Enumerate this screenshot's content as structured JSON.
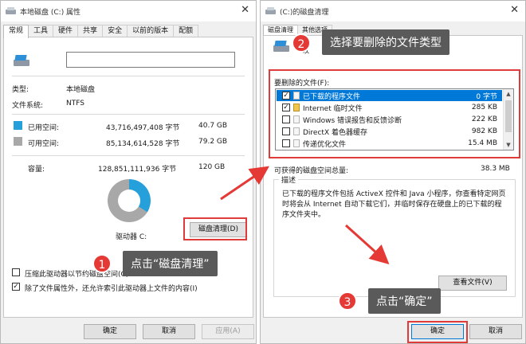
{
  "left_window": {
    "title": "本地磁盘 (C:) 属性",
    "tabs": [
      "常规",
      "工具",
      "硬件",
      "共享",
      "安全",
      "以前的版本",
      "配额"
    ],
    "type_label": "类型:",
    "type_value": "本地磁盘",
    "fs_label": "文件系统:",
    "fs_value": "NTFS",
    "used": {
      "label": "已用空间:",
      "bytes": "43,716,497,408 字节",
      "size": "40.7 GB",
      "color": "#26a0da"
    },
    "free": {
      "label": "可用空间:",
      "bytes": "85,134,614,528 字节",
      "size": "79.2 GB",
      "color": "#a8a8a8"
    },
    "capacity": {
      "label": "容量:",
      "bytes": "128,851,111,936 字节",
      "size": "120 GB"
    },
    "used_fraction": 0.339,
    "drive_label": "驱动器 C:",
    "cleanup_button": "磁盘清理(D)",
    "compress_text": "压缩此驱动器以节约磁盘空间(C)",
    "index_text": "除了文件属性外，还允许索引此驱动器上文件的内容(I)",
    "ok": "确定",
    "cancel": "取消",
    "apply": "应用(A)"
  },
  "right_window": {
    "title": "(C:)的磁盘清理",
    "tabs": [
      "磁盘清理",
      "其他选项"
    ],
    "intro_partial": "以",
    "files_label": "要删除的文件(F):",
    "files": [
      {
        "name": "已下载的程序文件",
        "size": "0 字节",
        "checked": true,
        "selected": true,
        "icon": "file-icon"
      },
      {
        "name": "Internet 临时文件",
        "size": "285 KB",
        "checked": true,
        "selected": false,
        "icon": "lock-icon"
      },
      {
        "name": "Windows 错误报告和反馈诊断",
        "size": "222 KB",
        "checked": false,
        "selected": false,
        "icon": "file-icon"
      },
      {
        "name": "DirectX 着色器缓存",
        "size": "982 KB",
        "checked": false,
        "selected": false,
        "icon": "file-icon"
      },
      {
        "name": "传递优化文件",
        "size": "15.4 MB",
        "checked": false,
        "selected": false,
        "icon": "file-icon"
      }
    ],
    "total_label": "可获得的磁盘空间总量:",
    "total_value": "38.3 MB",
    "desc_label": "描述",
    "desc_text": "已下载的程序文件包括 ActiveX 控件和 Java 小程序，你查看特定网页时将会从 Internet 自动下载它们，并临时保存在硬盘上的已下载的程序文件夹中。",
    "view_files": "查看文件(V)",
    "ok": "确定",
    "cancel": "取消"
  },
  "annotations": {
    "step1_num": "1",
    "step1_text": "点击“磁盘清理”",
    "step2_num": "2",
    "step2_text": "选择要删除的文件类型",
    "step3_num": "3",
    "step3_text": "点击“确定”",
    "highlight_color": "#e03b3b"
  }
}
